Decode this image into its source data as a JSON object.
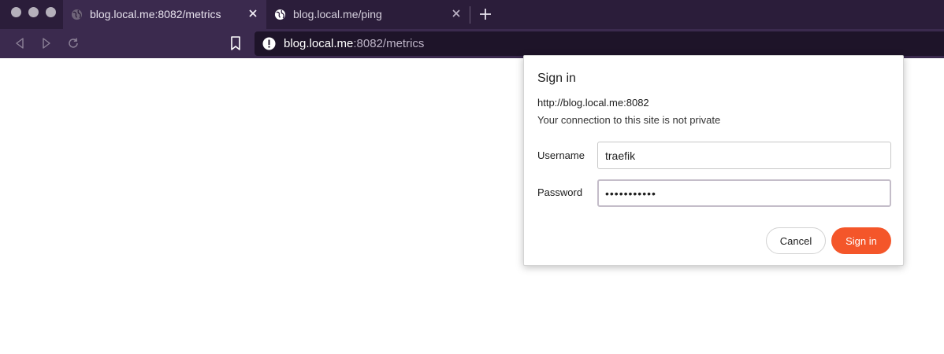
{
  "browser": {
    "tabs": [
      {
        "title": "blog.local.me:8082/metrics",
        "active": true,
        "favicon": "globe-icon"
      },
      {
        "title": "blog.local.me/ping",
        "active": false,
        "favicon": "globe-icon"
      }
    ],
    "address": {
      "host": "blog.local.me",
      "path": ":8082/metrics",
      "security_icon": "warning-icon"
    }
  },
  "dialog": {
    "title": "Sign in",
    "origin": "http://blog.local.me:8082",
    "note": "Your connection to this site is not private",
    "username_label": "Username",
    "username_value": "traefik",
    "password_label": "Password",
    "password_mask": "•••••••••••",
    "cancel_label": "Cancel",
    "signin_label": "Sign in"
  },
  "colors": {
    "tabstrip": "#2b1d3a",
    "toolbar": "#3b2a4e",
    "accent": "#f4562a"
  }
}
